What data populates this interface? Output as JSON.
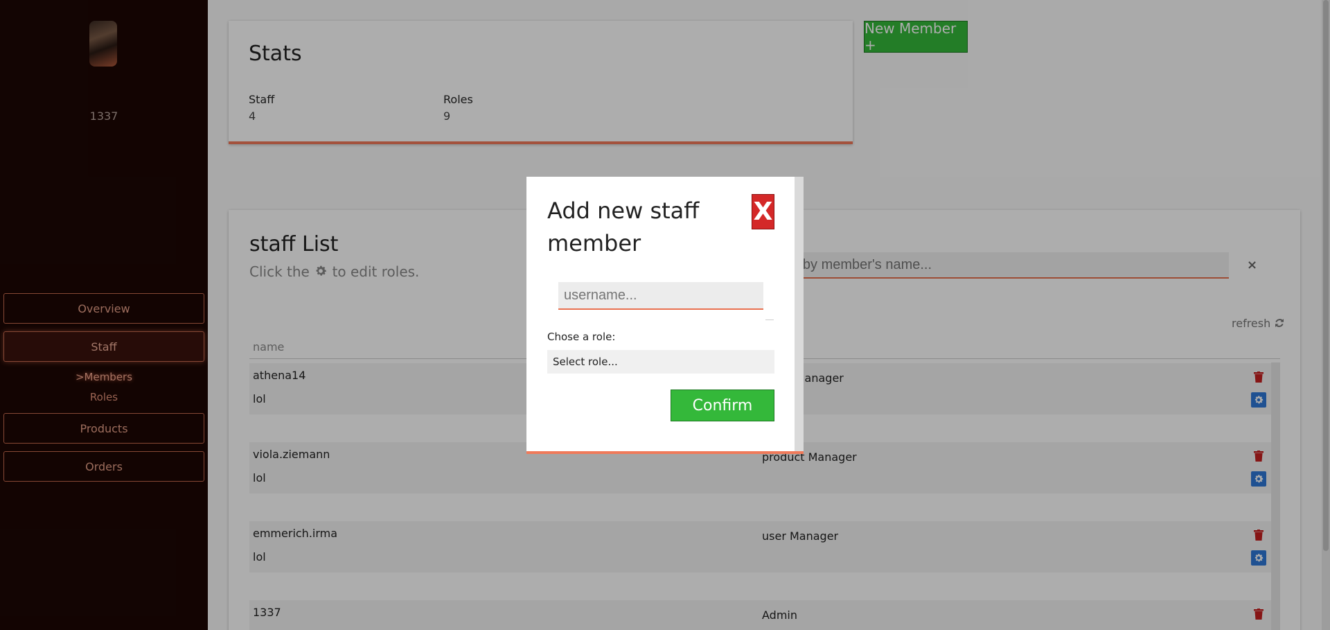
{
  "sidebar": {
    "user_id": "1337",
    "nav": {
      "overview": "Overview",
      "staff": "Staff",
      "members": ">Members",
      "roles": "Roles",
      "products": "Products",
      "orders": "Orders"
    }
  },
  "stats": {
    "title": "Stats",
    "staff_label": "Staff",
    "staff_value": "4",
    "roles_label": "Roles",
    "roles_value": "9"
  },
  "new_member_button": "New Member +",
  "staff_list": {
    "title": "staff List",
    "subtitle_before": "Click the",
    "subtitle_after": "to edit roles.",
    "search_placeholder": "Search by member's name...",
    "search_clear": "×",
    "refresh_label": "refresh",
    "column_name": "name",
    "rows": [
      {
        "name": "athena14",
        "note": "lol",
        "role": "order Manager"
      },
      {
        "name": "viola.ziemann",
        "note": "lol",
        "role": "product Manager"
      },
      {
        "name": "emmerich.irma",
        "note": "lol",
        "role": "user Manager"
      },
      {
        "name": "1337",
        "note": "",
        "role": "Admin"
      }
    ]
  },
  "modal": {
    "title": "Add new staff member",
    "close_label": "X",
    "username_placeholder": "username...",
    "role_label": "Chose a role:",
    "role_select_value": "Select role...",
    "confirm_label": "Confirm"
  },
  "colors": {
    "sidebar_bg": "#1c0704",
    "accent": "#f07a5a",
    "primary_green": "#34b83a",
    "danger_red": "#d42828",
    "gear_blue": "#2f78d8"
  }
}
